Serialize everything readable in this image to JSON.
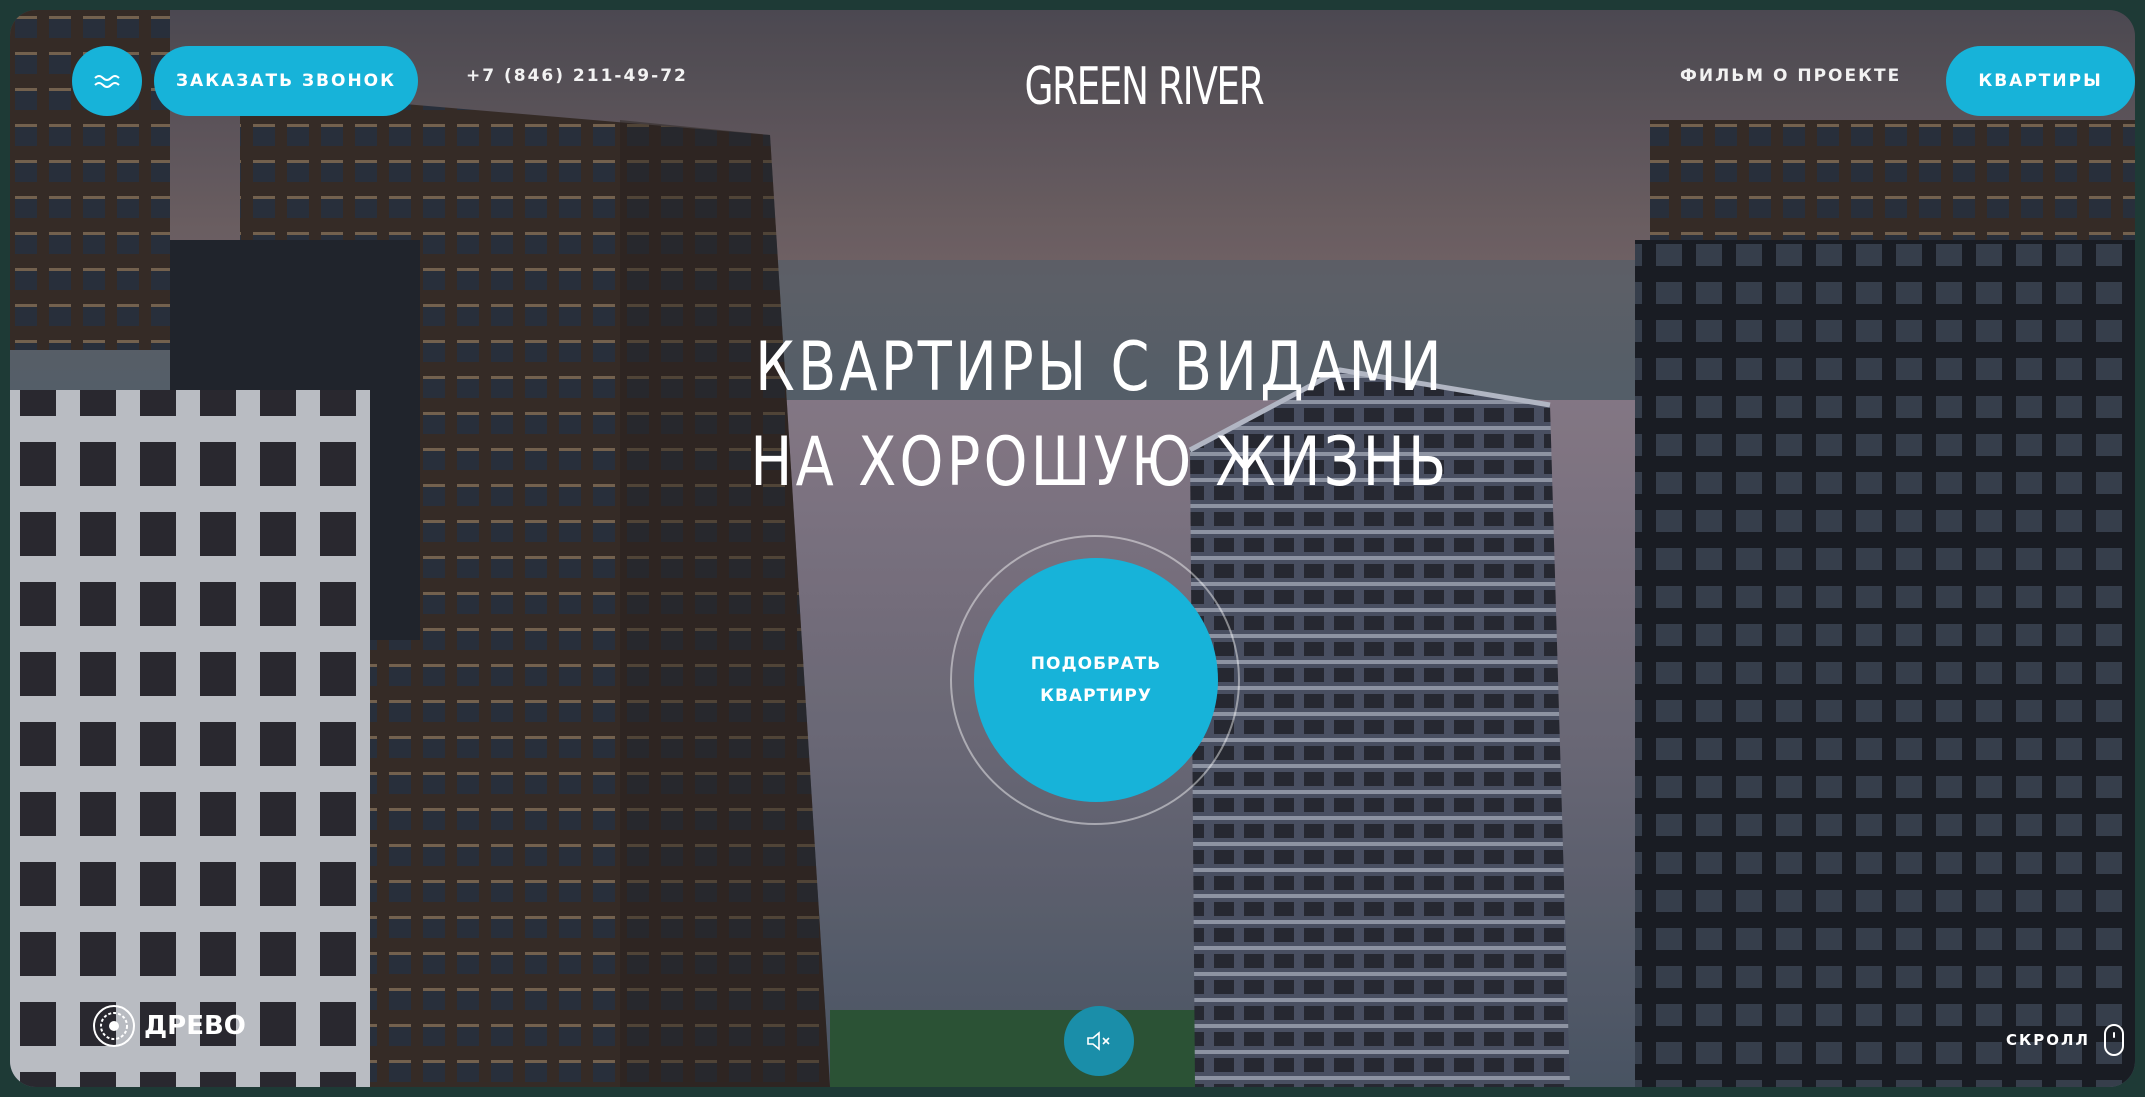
{
  "header": {
    "menu_icon": "waves-icon",
    "callback_label": "ЗАКАЗАТЬ ЗВОНОК",
    "phone": "+7 (846) 211-49-72",
    "logo": "GREEN RIVER",
    "film_link": "ФИЛЬМ О ПРОЕКТЕ",
    "apartments_label": "КВАРТИРЫ"
  },
  "hero": {
    "headline_line1": "КВАРТИРЫ С ВИДАМИ",
    "headline_line2": "НА ХОРОШУЮ ЖИЗНЬ",
    "cta_line1": "ПОДОБРАТЬ",
    "cta_line2": "КВАРТИРУ"
  },
  "footer": {
    "brand": "ДРЕВО",
    "brand_icon": "tree-logo-icon",
    "sound_icon": "speaker-muted-icon",
    "scroll_label": "СКРОЛЛ",
    "scroll_icon": "mouse-icon"
  },
  "colors": {
    "accent": "#17b3d9",
    "frame": "#1e3a36"
  }
}
